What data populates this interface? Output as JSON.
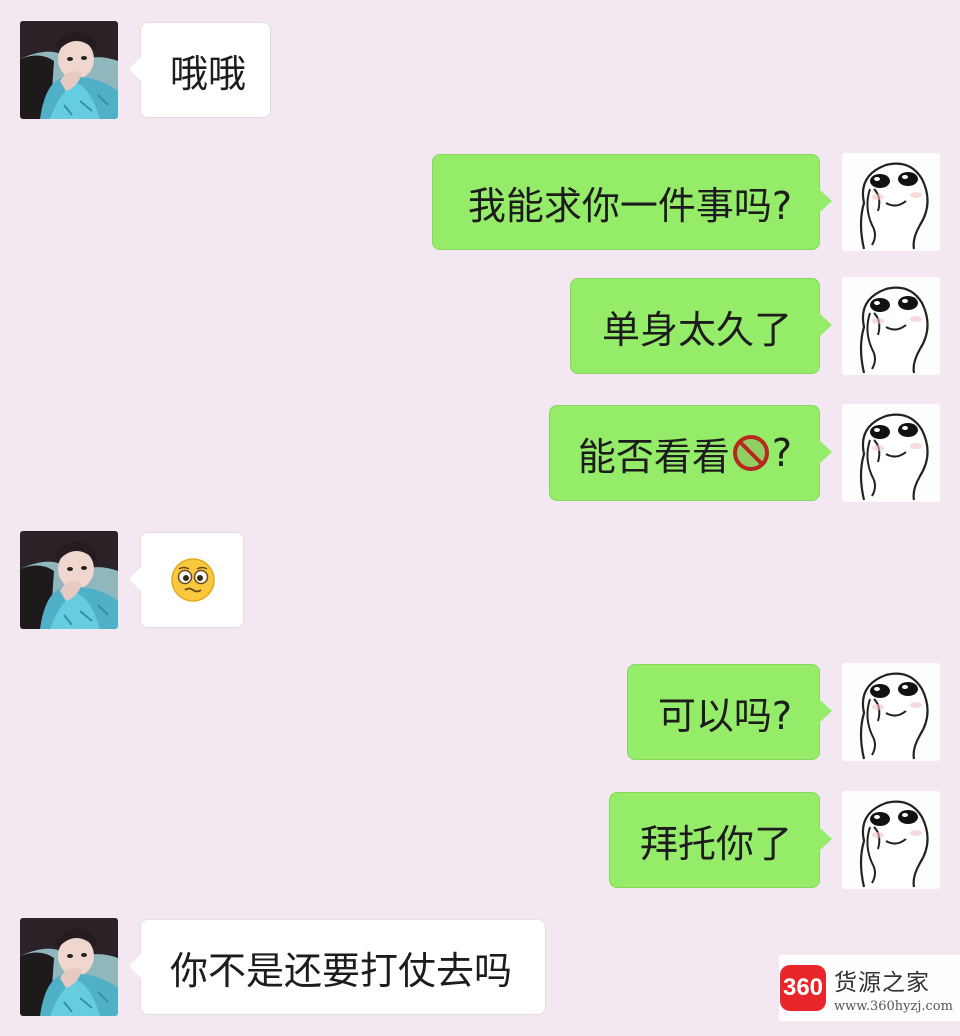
{
  "chat": {
    "messages": [
      {
        "side": "in",
        "text": "哦哦"
      },
      {
        "side": "out",
        "text": "我能求你一件事吗?"
      },
      {
        "side": "out",
        "text": "单身太久了"
      },
      {
        "side": "out",
        "text_before": "能否看看",
        "icon": "prohibited-icon",
        "text_after": "?"
      },
      {
        "side": "in",
        "icon": "pleading-face-emoji"
      },
      {
        "side": "out",
        "text": "可以吗?"
      },
      {
        "side": "out",
        "text": "拜托你了"
      },
      {
        "side": "in",
        "text": "你不是还要打仗去吗"
      }
    ]
  },
  "colors": {
    "background": "#f3e8f2",
    "outgoing_bubble": "#95ec69",
    "incoming_bubble": "#ffffff"
  },
  "watermark": {
    "logo": "360",
    "name": "货源之家",
    "url": "www.360hyzj.com"
  }
}
